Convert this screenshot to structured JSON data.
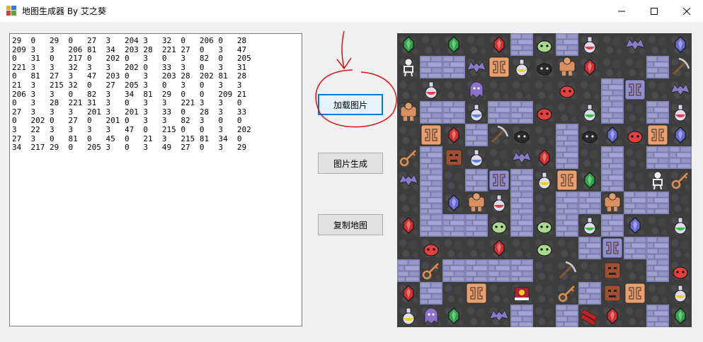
{
  "window": {
    "title": "地图生成器 By 艾之葵",
    "controls": [
      "minimize-icon",
      "maximize-icon",
      "close-icon"
    ]
  },
  "buttons": {
    "load_image": "加载图片",
    "generate_image": "图片生成",
    "copy_map": "复制地图"
  },
  "map_text": {
    "rows": [
      [
        "29",
        "0",
        "29",
        "0",
        "27",
        "3",
        "204",
        "3",
        "32",
        "0",
        "206",
        "0",
        "28"
      ],
      [
        "209",
        "3",
        "3",
        "206",
        "81",
        "34",
        "203",
        "28",
        "221",
        "27",
        "0",
        "3",
        "47"
      ],
      [
        "0",
        "31",
        "0",
        "217",
        "0",
        "202",
        "0",
        "3",
        "0",
        "3",
        "82",
        "0",
        "205"
      ],
      [
        "221",
        "3",
        "3",
        "32",
        "3",
        "3",
        "202",
        "0",
        "33",
        "3",
        "0",
        "3",
        "31"
      ],
      [
        "0",
        "81",
        "27",
        "3",
        "47",
        "203",
        "0",
        "3",
        "203",
        "28",
        "202",
        "81",
        "28"
      ],
      [
        "21",
        "3",
        "215",
        "32",
        "0",
        "27",
        "205",
        "3",
        "0",
        "3",
        "0",
        "3",
        "3"
      ],
      [
        "206",
        "3",
        "3",
        "0",
        "82",
        "3",
        "34",
        "81",
        "29",
        "0",
        "0",
        "209",
        "21"
      ],
      [
        "0",
        "3",
        "28",
        "221",
        "31",
        "3",
        "0",
        "3",
        "3",
        "221",
        "3",
        "3",
        "0"
      ],
      [
        "27",
        "3",
        "3",
        "3",
        "201",
        "3",
        "201",
        "3",
        "33",
        "0",
        "28",
        "3",
        "33"
      ],
      [
        "0",
        "202",
        "0",
        "27",
        "0",
        "201",
        "0",
        "3",
        "3",
        "82",
        "3",
        "0",
        "0"
      ],
      [
        "3",
        "22",
        "3",
        "3",
        "3",
        "3",
        "47",
        "0",
        "215",
        "0",
        "0",
        "3",
        "202"
      ],
      [
        "27",
        "3",
        "0",
        "81",
        "0",
        "45",
        "0",
        "21",
        "3",
        "215",
        "81",
        "34",
        "0"
      ],
      [
        "34",
        "217",
        "29",
        "0",
        "205",
        "3",
        "0",
        "3",
        "49",
        "27",
        "0",
        "3",
        "29"
      ]
    ]
  },
  "map_image": {
    "grid_size": 13,
    "tiles": [
      [
        "gem-green",
        "floor",
        "gem-green",
        "floor",
        "gem-red",
        "wall",
        "slime-green",
        "wall",
        "potion-red",
        "floor",
        "bat-purple",
        "floor",
        "gem-blue"
      ],
      [
        "skeleton",
        "wall",
        "wall",
        "bat-purple",
        "door-orange",
        "potion-yellow",
        "slime-black",
        "golem",
        "gem-red",
        "floor",
        "floor",
        "wall",
        "pickaxe"
      ],
      [
        "floor",
        "potion-red",
        "floor",
        "ghost-purple",
        "floor",
        "floor",
        "floor",
        "slime-red",
        "floor",
        "wall",
        "door-blue",
        "floor",
        "bat-purple"
      ],
      [
        "golem",
        "wall",
        "wall",
        "potion-blue",
        "wall",
        "wall",
        "slime-red",
        "floor",
        "potion-green",
        "wall",
        "floor",
        "wall",
        "potion-red"
      ],
      [
        "floor",
        "door-orange",
        "gem-red",
        "wall",
        "pickaxe",
        "slime-black",
        "floor",
        "wall",
        "slime-black",
        "gem-blue",
        "slime-red",
        "door-orange",
        "gem-blue"
      ],
      [
        "key",
        "wall",
        "totem",
        "potion-blue",
        "floor",
        "bat-purple",
        "gem-red",
        "wall",
        "floor",
        "wall",
        "floor",
        "wall",
        "wall"
      ],
      [
        "bat-purple",
        "wall",
        "floor",
        "wall",
        "door-blue",
        "wall",
        "potion-yellow",
        "door-orange",
        "gem-green",
        "wall",
        "floor",
        "skeleton",
        "key"
      ],
      [
        "floor",
        "wall",
        "gem-blue",
        "golem",
        "potion-red",
        "wall",
        "floor",
        "wall",
        "wall",
        "golem",
        "wall",
        "wall",
        "floor"
      ],
      [
        "gem-red",
        "wall",
        "wall",
        "wall",
        "slime-green",
        "wall",
        "slime-green",
        "wall",
        "potion-green",
        "wall",
        "gem-blue",
        "floor",
        "potion-green"
      ],
      [
        "floor",
        "slime-red",
        "floor",
        "floor",
        "gem-red",
        "floor",
        "slime-green",
        "floor",
        "wall",
        "door-blue",
        "wall",
        "wall",
        "floor"
      ],
      [
        "wall",
        "key",
        "wall",
        "wall",
        "wall",
        "wall",
        "floor",
        "pickaxe",
        "floor",
        "totem",
        "floor",
        "wall",
        "slime-red"
      ],
      [
        "gem-red",
        "wall",
        "floor",
        "door-orange",
        "floor",
        "book",
        "floor",
        "key",
        "wall",
        "totem",
        "door-orange",
        "floor",
        "potion-yellow"
      ],
      [
        "potion-yellow",
        "ghost-purple",
        "gem-green",
        "floor",
        "bat-purple",
        "wall",
        "floor",
        "wall",
        "dynamite",
        "gem-red",
        "floor",
        "wall",
        "gem-green"
      ]
    ]
  },
  "colors": {
    "floor": "#3e3e3e",
    "wall": "#8c8cbc",
    "window_bg": "#f0f0f0",
    "focus_border": "#0078d7",
    "annotation": "#e01010"
  }
}
